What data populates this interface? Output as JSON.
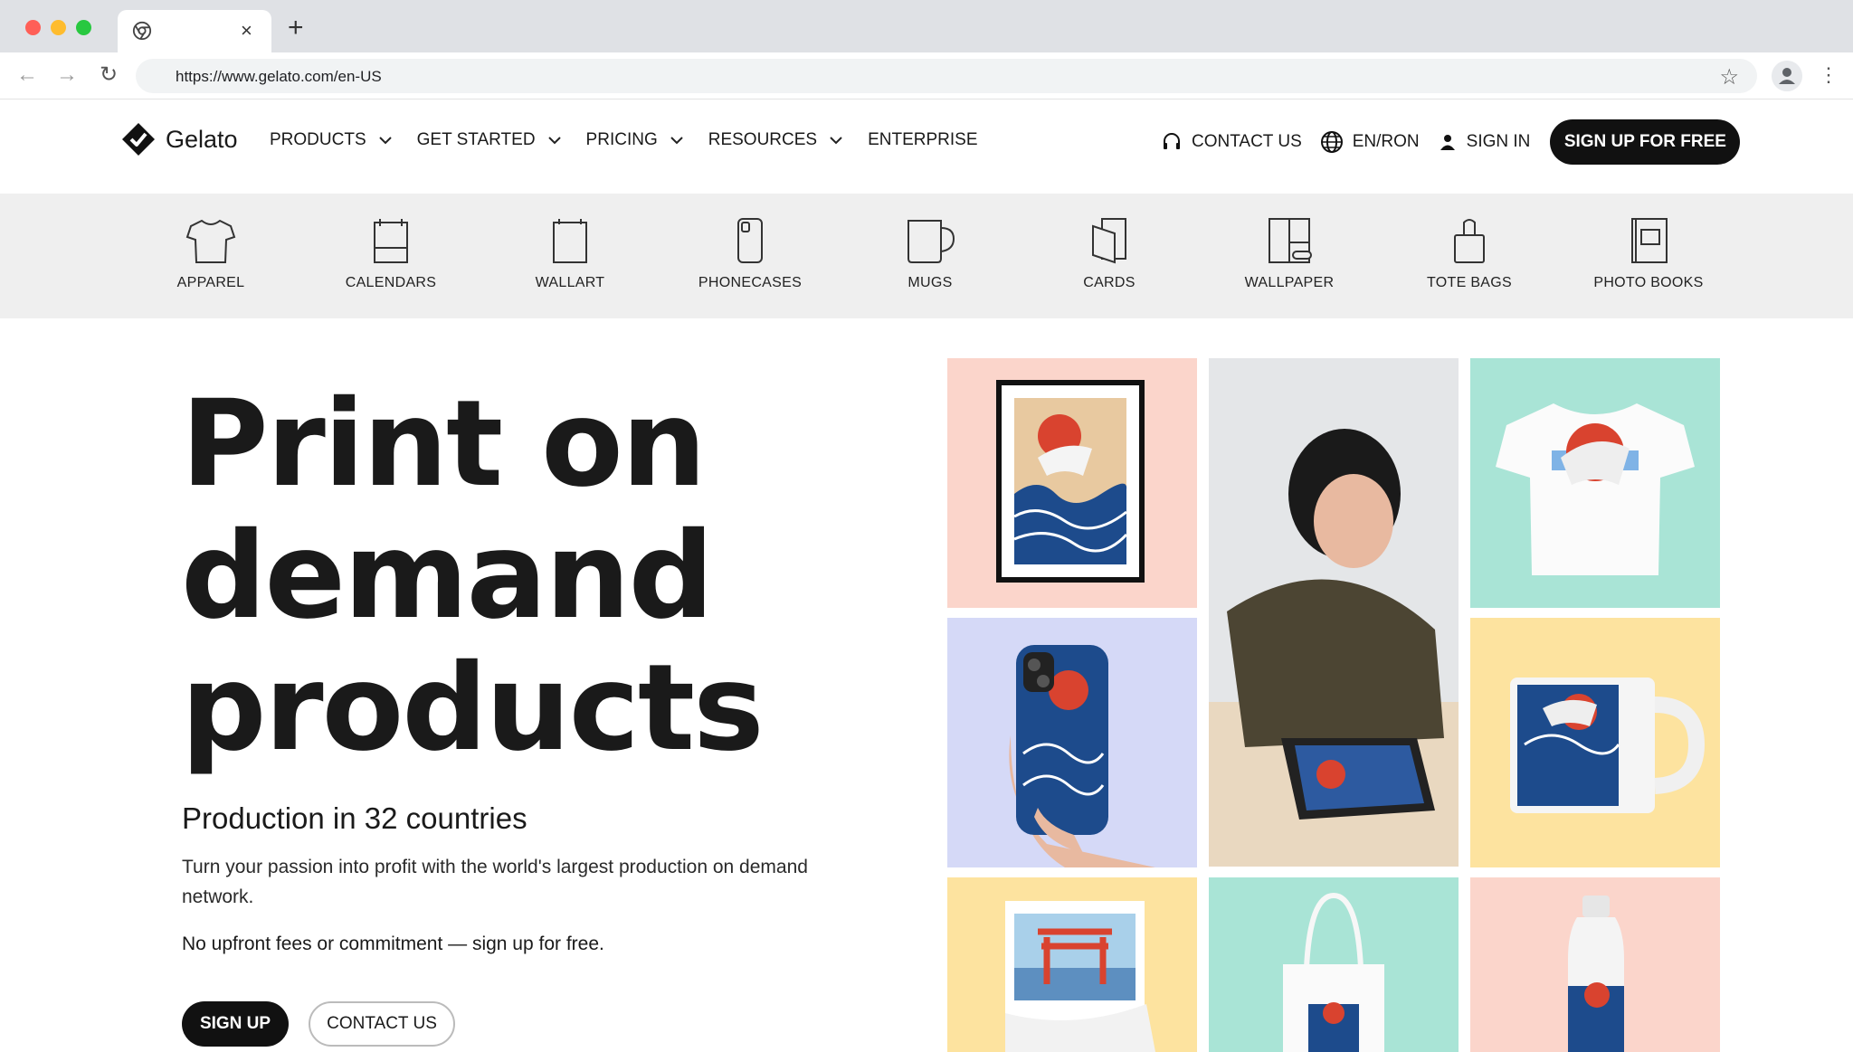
{
  "browser": {
    "url": "https://www.gelato.com/en-US",
    "tab_close": "×",
    "new_tab": "+"
  },
  "header": {
    "logo_text": "Gelato",
    "nav": [
      {
        "label": "PRODUCTS"
      },
      {
        "label": "GET STARTED"
      },
      {
        "label": "PRICING"
      },
      {
        "label": "RESOURCES"
      },
      {
        "label": "ENTERPRISE"
      }
    ],
    "contact_label": "CONTACT US",
    "language_label": "EN/RON",
    "signin_label": "SIGN IN",
    "signup_label": "SIGN UP FOR FREE"
  },
  "categories": [
    {
      "label": "APPAREL",
      "icon": "tshirt-icon"
    },
    {
      "label": "CALENDARS",
      "icon": "calendar-icon"
    },
    {
      "label": "WALLART",
      "icon": "wallart-icon"
    },
    {
      "label": "PHONECASES",
      "icon": "phonecase-icon"
    },
    {
      "label": "MUGS",
      "icon": "mug-icon"
    },
    {
      "label": "CARDS",
      "icon": "cards-icon"
    },
    {
      "label": "WALLPAPER",
      "icon": "wallpaper-icon"
    },
    {
      "label": "TOTE BAGS",
      "icon": "totebag-icon"
    },
    {
      "label": "PHOTO BOOKS",
      "icon": "photobook-icon"
    }
  ],
  "hero": {
    "title_line1": "Print on",
    "title_line2": "demand",
    "title_line3": "products",
    "subtitle": "Production in 32 countries",
    "description": "Turn your passion into profit with the world's largest production on demand network.",
    "note": "No upfront fees or commitment — sign up for free.",
    "primary_button": "SIGN UP",
    "secondary_button": "CONTACT US"
  },
  "colors": {
    "accent": "#111111",
    "tile_peach": "#fbd5cb",
    "tile_mint": "#a9e4d6",
    "tile_lavender": "#d5d9f7",
    "tile_yellow": "#fde39f",
    "category_bg": "#efefef"
  }
}
